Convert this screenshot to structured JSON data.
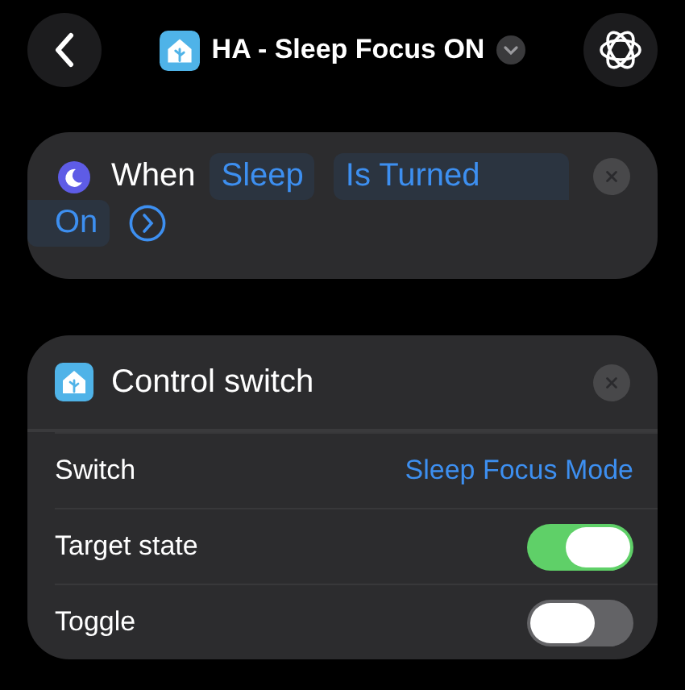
{
  "header": {
    "title": "HA - Sleep Focus ON"
  },
  "trigger": {
    "label": "When",
    "focus_parameter": "Sleep",
    "state_parameter_lines": [
      "Is Turned",
      "On"
    ]
  },
  "action": {
    "title": "Control switch",
    "rows": [
      {
        "kind": "value",
        "label": "Switch",
        "value": "Sleep Focus Mode"
      },
      {
        "kind": "toggle",
        "label": "Target state",
        "on": true
      },
      {
        "kind": "toggle",
        "label": "Toggle",
        "on": false
      }
    ]
  }
}
